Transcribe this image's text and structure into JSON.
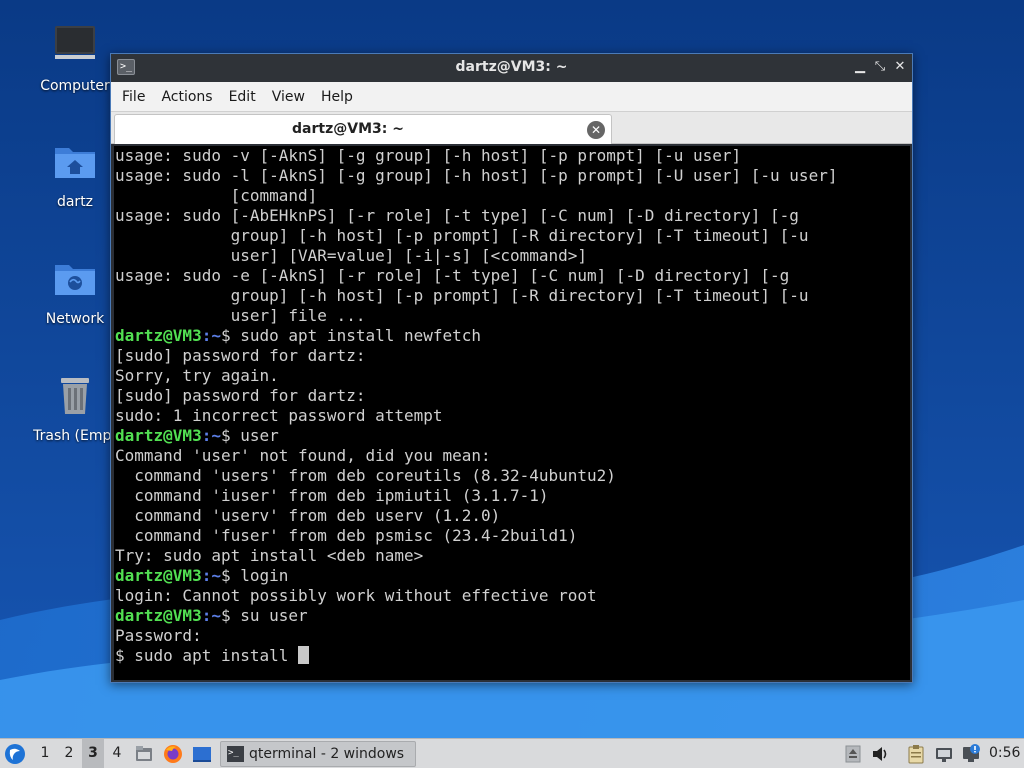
{
  "desktop": {
    "icons": [
      {
        "label": "Computer",
        "icon": "computer-icon"
      },
      {
        "label": "dartz",
        "icon": "home-folder-icon"
      },
      {
        "label": "Network",
        "icon": "network-folder-icon"
      },
      {
        "label": "Trash (Empt",
        "icon": "trash-icon"
      }
    ]
  },
  "window": {
    "title": "dartz@VM3: ~",
    "minimize_glyph": "▁",
    "maximize_glyph": "⤡",
    "close_glyph": "✕",
    "menu": [
      "File",
      "Actions",
      "Edit",
      "View",
      "Help"
    ],
    "tab_label": "dartz@VM3: ~",
    "tab_close_glyph": "✕"
  },
  "terminal": {
    "prompt_user": "dartz@VM3",
    "prompt_path": ":~",
    "lines": [
      {
        "type": "out",
        "text": "usage: sudo -v [-AknS] [-g group] [-h host] [-p prompt] [-u user]"
      },
      {
        "type": "out",
        "text": "usage: sudo -l [-AknS] [-g group] [-h host] [-p prompt] [-U user] [-u user]"
      },
      {
        "type": "out",
        "text": "            [command]"
      },
      {
        "type": "out",
        "text": "usage: sudo [-AbEHknPS] [-r role] [-t type] [-C num] [-D directory] [-g"
      },
      {
        "type": "out",
        "text": "            group] [-h host] [-p prompt] [-R directory] [-T timeout] [-u"
      },
      {
        "type": "out",
        "text": "            user] [VAR=value] [-i|-s] [<command>]"
      },
      {
        "type": "out",
        "text": "usage: sudo -e [-AknS] [-r role] [-t type] [-C num] [-D directory] [-g"
      },
      {
        "type": "out",
        "text": "            group] [-h host] [-p prompt] [-R directory] [-T timeout] [-u"
      },
      {
        "type": "out",
        "text": "            user] file ..."
      },
      {
        "type": "cmd",
        "text": "$ sudo apt install newfetch"
      },
      {
        "type": "out",
        "text": "[sudo] password for dartz:"
      },
      {
        "type": "out",
        "text": "Sorry, try again."
      },
      {
        "type": "out",
        "text": "[sudo] password for dartz:"
      },
      {
        "type": "out",
        "text": "sudo: 1 incorrect password attempt"
      },
      {
        "type": "cmd",
        "text": "$ user"
      },
      {
        "type": "out",
        "text": "Command 'user' not found, did you mean:"
      },
      {
        "type": "out",
        "text": "  command 'users' from deb coreutils (8.32-4ubuntu2)"
      },
      {
        "type": "out",
        "text": "  command 'iuser' from deb ipmiutil (3.1.7-1)"
      },
      {
        "type": "out",
        "text": "  command 'userv' from deb userv (1.2.0)"
      },
      {
        "type": "out",
        "text": "  command 'fuser' from deb psmisc (23.4-2build1)"
      },
      {
        "type": "out",
        "text": "Try: sudo apt install <deb name>"
      },
      {
        "type": "cmd",
        "text": "$ login"
      },
      {
        "type": "out",
        "text": "login: Cannot possibly work without effective root"
      },
      {
        "type": "cmd",
        "text": "$ su user"
      },
      {
        "type": "out",
        "text": "Password:"
      },
      {
        "type": "input",
        "text": "$ sudo apt install "
      }
    ]
  },
  "taskbar": {
    "start_icon": "lxqt-start-icon",
    "workspaces": [
      "1",
      "2",
      "3",
      "4"
    ],
    "active_workspace": "3",
    "quicklaunch": [
      "file-manager-icon",
      "firefox-icon",
      "show-desktop-icon"
    ],
    "task_label": "qterminal - 2 windows",
    "tray": [
      "eject-icon",
      "volume-icon",
      "clipboard-icon",
      "network-icon",
      "update-notifier-icon"
    ],
    "clock": "0:56"
  },
  "colors": {
    "prompt_user": "#52e052",
    "prompt_path": "#5c7fe6",
    "console_bg": "#000000",
    "console_fg": "#d0d0d0",
    "wallpaper": "#0d3f8f"
  }
}
